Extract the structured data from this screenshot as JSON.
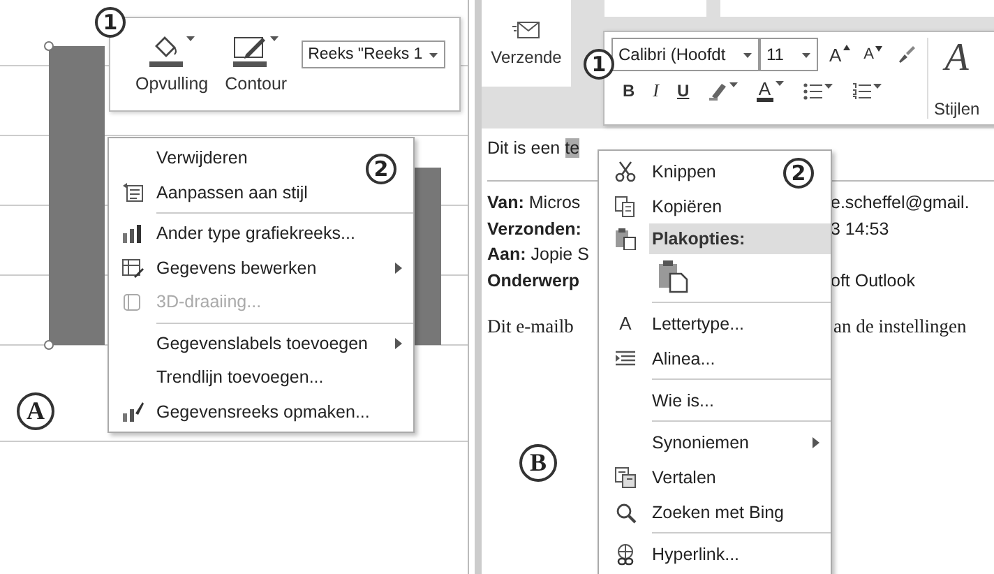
{
  "panel_a": {
    "label": "A",
    "mini_toolbar": {
      "callout": "1",
      "buttons": [
        {
          "label": "Opvulling"
        },
        {
          "label": "Contour"
        }
      ],
      "series_dropdown": "Reeks \"Reeks 1"
    },
    "context_menu": {
      "callout": "2",
      "groups": [
        {
          "items": [
            {
              "label": "Verwijderen",
              "disabled": false,
              "submenu": false
            },
            {
              "label": "Aanpassen aan stijl",
              "disabled": false,
              "submenu": false
            }
          ]
        },
        {
          "items": [
            {
              "label": "Ander type grafiekreeks...",
              "disabled": false,
              "submenu": false
            },
            {
              "label": "Gegevens bewerken",
              "disabled": false,
              "submenu": true
            },
            {
              "label": "3D-draaiing...",
              "disabled": true,
              "submenu": false
            }
          ]
        },
        {
          "items": [
            {
              "label": "Gegevenslabels toevoegen",
              "disabled": false,
              "submenu": true
            },
            {
              "label": "Trendlijn toevoegen...",
              "disabled": false,
              "submenu": false
            },
            {
              "label": "Gegevensreeks opmaken...",
              "disabled": false,
              "submenu": false
            }
          ]
        }
      ]
    }
  },
  "panel_b": {
    "label": "B",
    "ribbon": {
      "send_button": "Verzende"
    },
    "mini_toolbar": {
      "callout": "1",
      "font": "Calibri (Hoofdt",
      "size": "11",
      "grow_glyph": "A",
      "shrink_glyph": "A",
      "format_buttons": [
        "B",
        "I",
        "U"
      ],
      "color_glyph": "A",
      "styles_glyph": "A",
      "styles_label": "Stijlen"
    },
    "document": {
      "first_line": "Dit is een ",
      "selection": "te",
      "header_lines": [
        {
          "label": "Van:",
          "text": "Micros",
          "right": "e.scheffel@gmail."
        },
        {
          "label": "Verzonden:",
          "right": "3 14:53"
        },
        {
          "label": "Aan:",
          "text": "Jopie S"
        },
        {
          "label": "Onderwerp",
          "right": "oft Outlook"
        }
      ],
      "body_left": "Dit e-mailb",
      "body_right": "an de instellingen"
    },
    "context_menu": {
      "callout": "2",
      "groups": [
        {
          "items": [
            {
              "kind": "item",
              "label": "Knippen",
              "submenu": false
            },
            {
              "kind": "item",
              "label": "Kopiëren",
              "submenu": false
            },
            {
              "kind": "header",
              "label": "Plakopties:",
              "submenu": false
            },
            {
              "kind": "paste-option",
              "submenu": false
            }
          ]
        },
        {
          "items": [
            {
              "kind": "item",
              "label": "Lettertype...",
              "glyph": "A",
              "submenu": false
            },
            {
              "kind": "item",
              "label": "Alinea...",
              "submenu": false
            }
          ]
        },
        {
          "items": [
            {
              "kind": "item",
              "label": "Wie is...",
              "submenu": false
            }
          ]
        },
        {
          "items": [
            {
              "kind": "item",
              "label": "Synoniemen",
              "submenu": true
            },
            {
              "kind": "item",
              "label": "Vertalen",
              "submenu": false
            },
            {
              "kind": "item",
              "label": "Zoeken met Bing",
              "submenu": false
            }
          ]
        },
        {
          "items": [
            {
              "kind": "item",
              "label": "Hyperlink...",
              "submenu": false
            }
          ]
        }
      ]
    }
  }
}
